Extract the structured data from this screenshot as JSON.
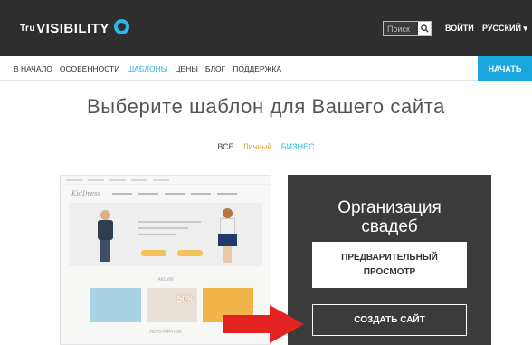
{
  "header": {
    "logo_prefix": "Tru",
    "logo_text": "VISIBILITY",
    "search_placeholder": "Поиск",
    "login": "ВОЙТИ",
    "language": "РУССКИЙ ▾"
  },
  "nav": {
    "items": [
      {
        "label": "В НАЧАЛО"
      },
      {
        "label": "ОСОБЕННОСТИ"
      },
      {
        "label": "ШАБЛОНЫ",
        "active": true
      },
      {
        "label": "ЦЕНЫ"
      },
      {
        "label": "БЛОГ"
      },
      {
        "label": "ПОДДЕРЖКА"
      }
    ],
    "start_button": "НАЧАТЬ"
  },
  "main": {
    "headline": "Выберите шаблон для Вашего сайта",
    "filters": [
      "ВСЕ",
      "Личный",
      "БИЗНЕС"
    ]
  },
  "template_preview": {
    "logo": "KidDress",
    "section_label": "АКЦИИ",
    "promo": "50%",
    "footer_label": "ПОПУЛЯРНОЕ"
  },
  "template_card": {
    "title_line1": "Организация",
    "title_line2": "свадеб",
    "preview_line1": "ПРЕДВАРИТЕЛЬНЫЙ",
    "preview_line2": "ПРОСМОТР",
    "create_button": "СОЗДАТЬ САЙТ"
  },
  "colors": {
    "header_bg": "#2e2e2e",
    "accent": "#2bb7e6",
    "start_button_bg": "#1aa7e0",
    "arrow": "#e32222"
  }
}
